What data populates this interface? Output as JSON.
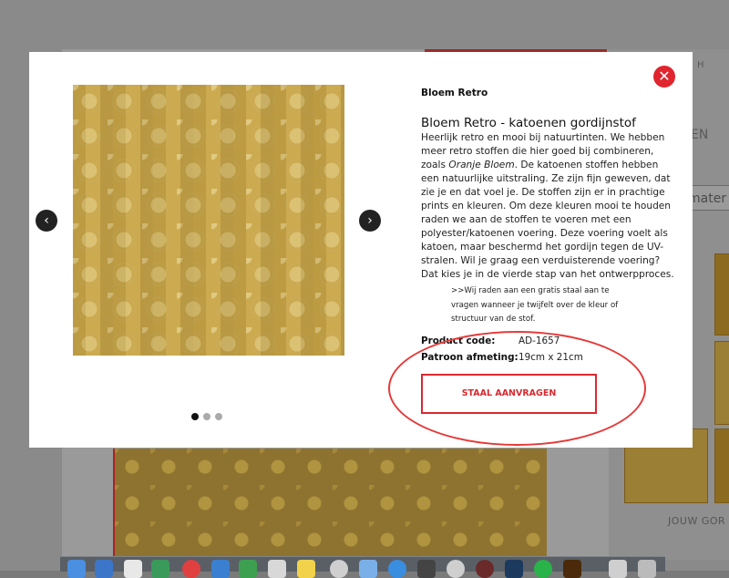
{
  "background": {
    "right_panel_texts": [
      "H",
      "EN",
      "mater"
    ],
    "jouw_label": "JOUW GOR"
  },
  "modal": {
    "header_title": "Bloem Retro",
    "product_title": "Bloem Retro - katoenen gordijnstof",
    "description_parts": {
      "p1": "Heerlijk retro en mooi bij natuurtinten. We hebben meer retro stoffen die hier goed bij combineren, zoals ",
      "p1_italic": "Oranje Bloem",
      "p2": ". De katoenen stoffen hebben een natuurlijke uitstraling. Ze zijn fijn geweven, dat zie je en dat voel je. De stoffen zijn er in prachtige prints en kleuren. Om deze kleuren mooi te houden raden we aan de stoffen te voeren met een polyester/katoenen voering. Deze voering voelt als katoen, maar beschermd het gordijn tegen de UV-stralen. Wil je graag een verduisterende voering? Dat kies je in de vierde stap van het ontwerpproces."
    },
    "note": ">>Wij raden aan een gratis staal aan te vragen wanneer je twijfelt over de kleur of structuur van de stof.",
    "specs": {
      "product_code_label": "Product code:",
      "product_code_value": "AD-1657",
      "pattern_label": "Patroon afmeting:",
      "pattern_value": "19cm x 21cm"
    },
    "cta_label": "STAAL AANVRAGEN",
    "close_icon": "close-icon",
    "prev_icon": "chevron-left-icon",
    "next_icon": "chevron-right-icon",
    "carousel": {
      "total": 3,
      "active": 1
    }
  },
  "colors": {
    "accent_red": "#d8292f",
    "fabric_gold": "#c8a547"
  }
}
